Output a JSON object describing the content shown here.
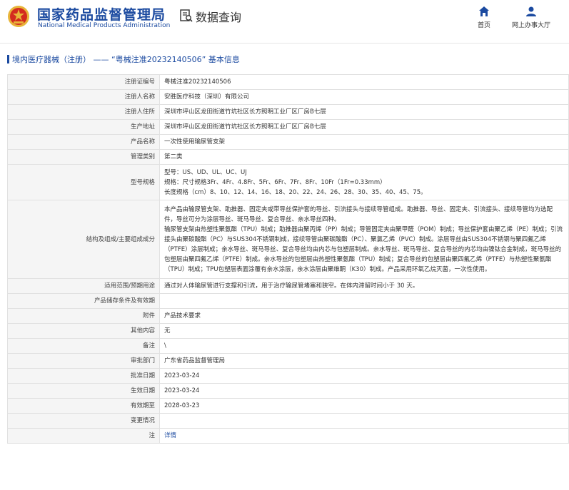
{
  "header": {
    "site_title": "国家药品监督管理局",
    "site_subtitle": "National Medical Products Administration",
    "section_label": "数据查询",
    "nav": [
      {
        "label": "首页",
        "icon": "home-icon"
      },
      {
        "label": "网上办事大厅",
        "icon": "user-icon"
      }
    ]
  },
  "breadcrumb": "境内医疗器械（注册） —— “粤械注准20232140506” 基本信息",
  "rows": [
    {
      "label": "注册证编号",
      "value": "粤械注准20232140506"
    },
    {
      "label": "注册人名称",
      "value": "安胜医疗科技（深圳）有限公司"
    },
    {
      "label": "注册人住所",
      "value": "深圳市坪山区龙田街道竹坑社区长方照明工业厂区厂房B七层"
    },
    {
      "label": "生产地址",
      "value": "深圳市坪山区龙田街道竹坑社区长方照明工业厂区厂房B七层"
    },
    {
      "label": "产品名称",
      "value": "一次性使用输尿管支架"
    },
    {
      "label": "管理类别",
      "value": "第二类"
    },
    {
      "label": "型号规格",
      "lines": [
        "型号：US、UD、UL、UC、UJ",
        "规格：尺寸规格3Fr、4Fr、4.8Fr、5Fr、6Fr、7Fr、8Fr、10Fr（1Fr=0.33mm）",
        "长度规格（cm）8、10、12、14、16、18、20、22、24、26、28、30、35、40、45、75。"
      ]
    },
    {
      "label": "结构及组成/主要组成成分",
      "lines": [
        "本产品由输尿管支架、助推器、固定夹或带导丝保护套的导丝、引流接头与接续导管组成。助推器、导丝、固定夹、引流接头、接续导管均为选配件，导丝可分为涂层导丝、斑马导丝、复合导丝、亲水导丝四种。",
        "输尿管支架由热塑性聚氨酯（TPU）制成；助推器由聚丙烯（PP）制成；导管固定夹由聚甲醛（POM）制成；导丝保护套由聚乙烯（PE）制成；引流接头由聚碳酸酯（PC）与SUS304不锈钢制成，接续导管由聚碳酸酯（PC）、聚氯乙烯（PVC）制成。涂层导丝由SUS304不锈钢与聚四氟乙烯（PTFE）涂层制成；亲水导丝、斑马导丝、复合导丝均由内芯与包塑层制成。亲水导丝、斑马导丝、复合导丝的内芯均由镍钛合金制成，斑马导丝的包塑层由聚四氟乙烯（PTFE）制成。亲水导丝的包塑层由热塑性聚氨酯（TPU）制成；复合导丝的包塑层由聚四氟乙烯（PTFE）与热塑性聚氨酯（TPU）制成；TPU包塑层表面涂覆有亲水涂层，亲水涂层由聚维酮（K30）制成。产品采用环氧乙烷灭菌，一次性使用。"
      ]
    },
    {
      "label": "适用范围/预期用途",
      "value": "通过对人体输尿管进行支撑和引流，用于治疗输尿管堵塞和狭窄。在体内滞留时间小于 30 天。"
    },
    {
      "label": "产品储存条件及有效期",
      "value": ""
    },
    {
      "label": "附件",
      "value": "产品技术要求"
    },
    {
      "label": "其他内容",
      "value": "无"
    },
    {
      "label": "备注",
      "value": "\\"
    },
    {
      "label": "审批部门",
      "value": "广东省药品监督管理局"
    },
    {
      "label": "批准日期",
      "value": "2023-03-24"
    },
    {
      "label": "生效日期",
      "value": "2023-03-24"
    },
    {
      "label": "有效期至",
      "value": "2028-03-23"
    },
    {
      "label": "变更情况",
      "value": ""
    },
    {
      "label": "注",
      "value": "详情",
      "link": true
    }
  ],
  "colors": {
    "brand": "#1b4aa0",
    "emblem_red": "#d32b1f",
    "emblem_gold": "#e8b53a"
  }
}
